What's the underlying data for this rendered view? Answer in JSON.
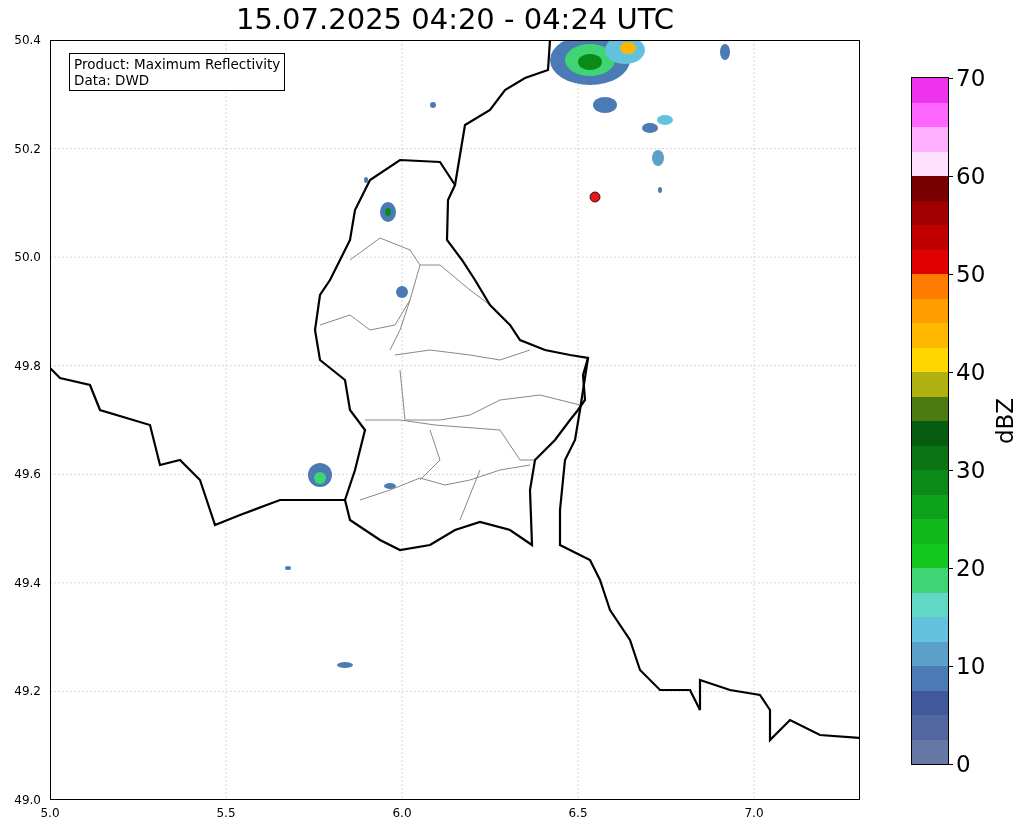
{
  "title": "15.07.2025 04:20 - 04:24 UTC",
  "info_box": {
    "lines": [
      "Product: Maximum Reflectivity",
      "Data: DWD"
    ]
  },
  "x_ticks": [
    "5.0",
    "5.5",
    "6.0",
    "6.5",
    "7.0"
  ],
  "y_ticks": [
    "50.4",
    "50.2",
    "50.0",
    "49.8",
    "49.6",
    "49.4",
    "49.2",
    "49.0"
  ],
  "colorbar": {
    "label": "dBZ",
    "ticks": [
      "70",
      "60",
      "50",
      "40",
      "30",
      "20",
      "10",
      "0"
    ],
    "segments": [
      {
        "color": "#ee33ee"
      },
      {
        "color": "#ff66ff"
      },
      {
        "color": "#ffb0ff"
      },
      {
        "color": "#ffe0ff"
      },
      {
        "color": "#780000"
      },
      {
        "color": "#a00000"
      },
      {
        "color": "#c00000"
      },
      {
        "color": "#e00000"
      },
      {
        "color": "#ff7c00"
      },
      {
        "color": "#ff9c00"
      },
      {
        "color": "#ffb800"
      },
      {
        "color": "#ffd600"
      },
      {
        "color": "#b0b010"
      },
      {
        "color": "#4a7a10"
      },
      {
        "color": "#085c10"
      },
      {
        "color": "#0a7414"
      },
      {
        "color": "#0c8a18"
      },
      {
        "color": "#0ea21a"
      },
      {
        "color": "#10b81c"
      },
      {
        "color": "#12c81e"
      },
      {
        "color": "#3fd574"
      },
      {
        "color": "#61d7c6"
      },
      {
        "color": "#65c2de"
      },
      {
        "color": "#5aa0c8"
      },
      {
        "color": "#4b7bb4"
      },
      {
        "color": "#41589d"
      },
      {
        "color": "#52669f"
      },
      {
        "color": "#6577a5"
      }
    ]
  }
}
